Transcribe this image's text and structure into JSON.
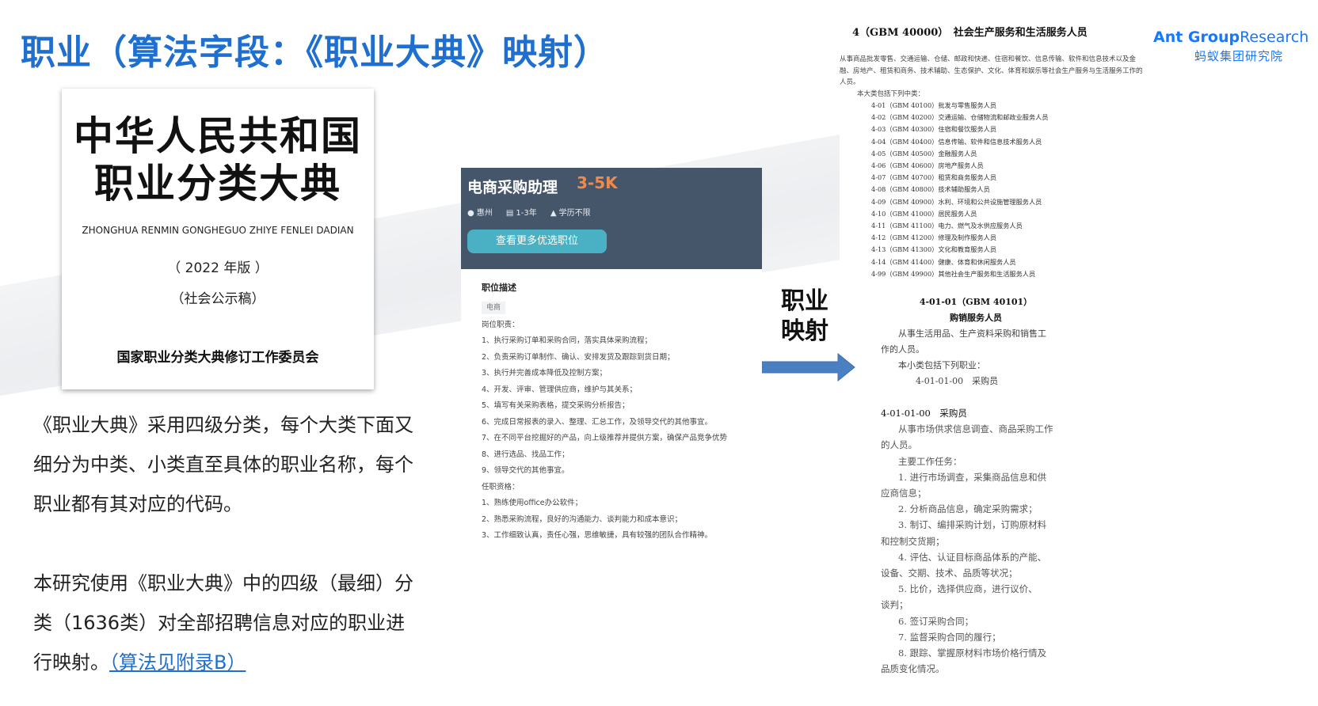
{
  "slide": {
    "title": "职业（算法字段：《职业大典》映射）",
    "logo_en_bold": "Ant Group",
    "logo_en_light": "Research",
    "logo_cn": "蚂蚁集团研究院"
  },
  "book": {
    "title_line1": "中华人民共和国",
    "title_line2": "职业分类大典",
    "pinyin": "ZHONGHUA RENMIN GONGHEGUO ZHIYE FENLEI DADIAN",
    "edition": "（ 2022 年版 ）",
    "note": "（社会公示稿）",
    "publisher": "国家职业分类大典修订工作委员会"
  },
  "text": {
    "para1": "《职业大典》采用四级分类，每个大类下面又细分为中类、小类直至具体的职业名称，每个职业都有其对应的代码。",
    "para2_main": "本研究使用《职业大典》中的四级（最细）分类（1636类）对全部招聘信息对应的职业进行映射。",
    "para2_link": "（算法见附录B）"
  },
  "job_card": {
    "title": "电商采购助理",
    "salary": "3-5K",
    "location": "惠州",
    "experience": "1-3年",
    "education": "学历不限",
    "button": "查看更多优选职位",
    "desc_heading": "职位描述",
    "tag": "电商",
    "duties_heading": "岗位职责：",
    "duties": [
      "1、执行采购订单和采购合同，落实具体采购流程；",
      "2、负责采购订单制作、确认、安排发货及跟踪到货日期；",
      "3、执行并完善成本降低及控制方案；",
      "4、开发、评审、管理供应商，维护与其关系；",
      "5、填写有关采购表格，提交采购分析报告；",
      "6、完成日常报表的录入、整理、汇总工作，及领导交代的其他事宜。",
      "7、在不同平台挖掘好的产品，向上级推荐并提供方案，确保产品竞争优势",
      "8、进行选品、找品工作；",
      "9、领导交代的其他事宜。"
    ],
    "req_heading": "任职资格：",
    "requirements": [
      "1、熟练使用office办公软件；",
      "2、熟悉采购流程，良好的沟通能力、谈判能力和成本意识；",
      "3、工作细致认真，责任心强，思维敏捷，具有较强的团队合作精神。"
    ]
  },
  "mapping": {
    "line1": "职业",
    "line2": "映射"
  },
  "doc1": {
    "heading": "4（GBM 40000）　社会生产服务和生活服务人员",
    "description": "从事商品批发零售、交通运输、仓储、邮政和快递、住宿和餐饮、信息传输、软件和信息技术以及金融、房地产、租赁和商务、技术辅助、生态保护、文化、体育和娱乐等社会生产服务与生活服务工作的人员。",
    "intro": "本大类包括下列中类：",
    "classes": [
      "4-01（GBM 40100）批发与零售服务人员",
      "4-02（GBM 40200）交通运输、仓储物流和邮政业服务人员",
      "4-03（GBM 40300）住宿和餐饮服务人员",
      "4-04（GBM 40400）信息传输、软件和信息技术服务人员",
      "4-05（GBM 40500）金融服务人员",
      "4-06（GBM 40600）房地产服务人员",
      "4-07（GBM 40700）租赁和商务服务人员",
      "4-08（GBM 40800）技术辅助服务人员",
      "4-09（GBM 40900）水利、环境和公共设施管理服务人员",
      "4-10（GBM 41000）居民服务人员",
      "4-11（GBM 41100）电力、燃气及水供应服务人员",
      "4-12（GBM 41200）修理及制作服务人员",
      "4-13（GBM 41300）文化和教育服务人员",
      "4-14（GBM 41400）健康、体育和休闲服务人员",
      "4-99（GBM 49900）其他社会生产服务和生活服务人员"
    ]
  },
  "doc2": {
    "code": "4-01-01（GBM 40101）",
    "name": "购销服务人员",
    "desc_line1": "从事生活用品、生产资料采购和销售工",
    "desc_line2": "作的人员。",
    "intro": "本小类包括下列职业：",
    "item": "4-01-01-00　采购员"
  },
  "doc3": {
    "heading": "4-01-01-00　采购员",
    "lines": [
      "从事市场供求信息调查、商品采购工作",
      "的人员。",
      "主要工作任务：",
      "1. 进行市场调查，采集商品信息和供",
      "应商信息；",
      "2. 分析商品信息，确定采购需求；",
      "3. 制订、编排采购计划，订购原材料",
      "和控制交货期；",
      "4. 评估、认证目标商品体系的产能、",
      "设备、交期、技术、品质等状况；",
      "5. 比价，选择供应商，进行议价、",
      "谈判；",
      "6. 签订采购合同；",
      "7. 监督采购合同的履行；",
      "8. 跟踪、掌握原材料市场价格行情及",
      "品质变化情况。"
    ]
  },
  "colors": {
    "title_blue": "#1f6fd0",
    "card_header": "#45566a",
    "salary_orange": "#f08a4b",
    "button_teal": "#4ab1c4",
    "arrow_blue": "#4a7fc1"
  }
}
